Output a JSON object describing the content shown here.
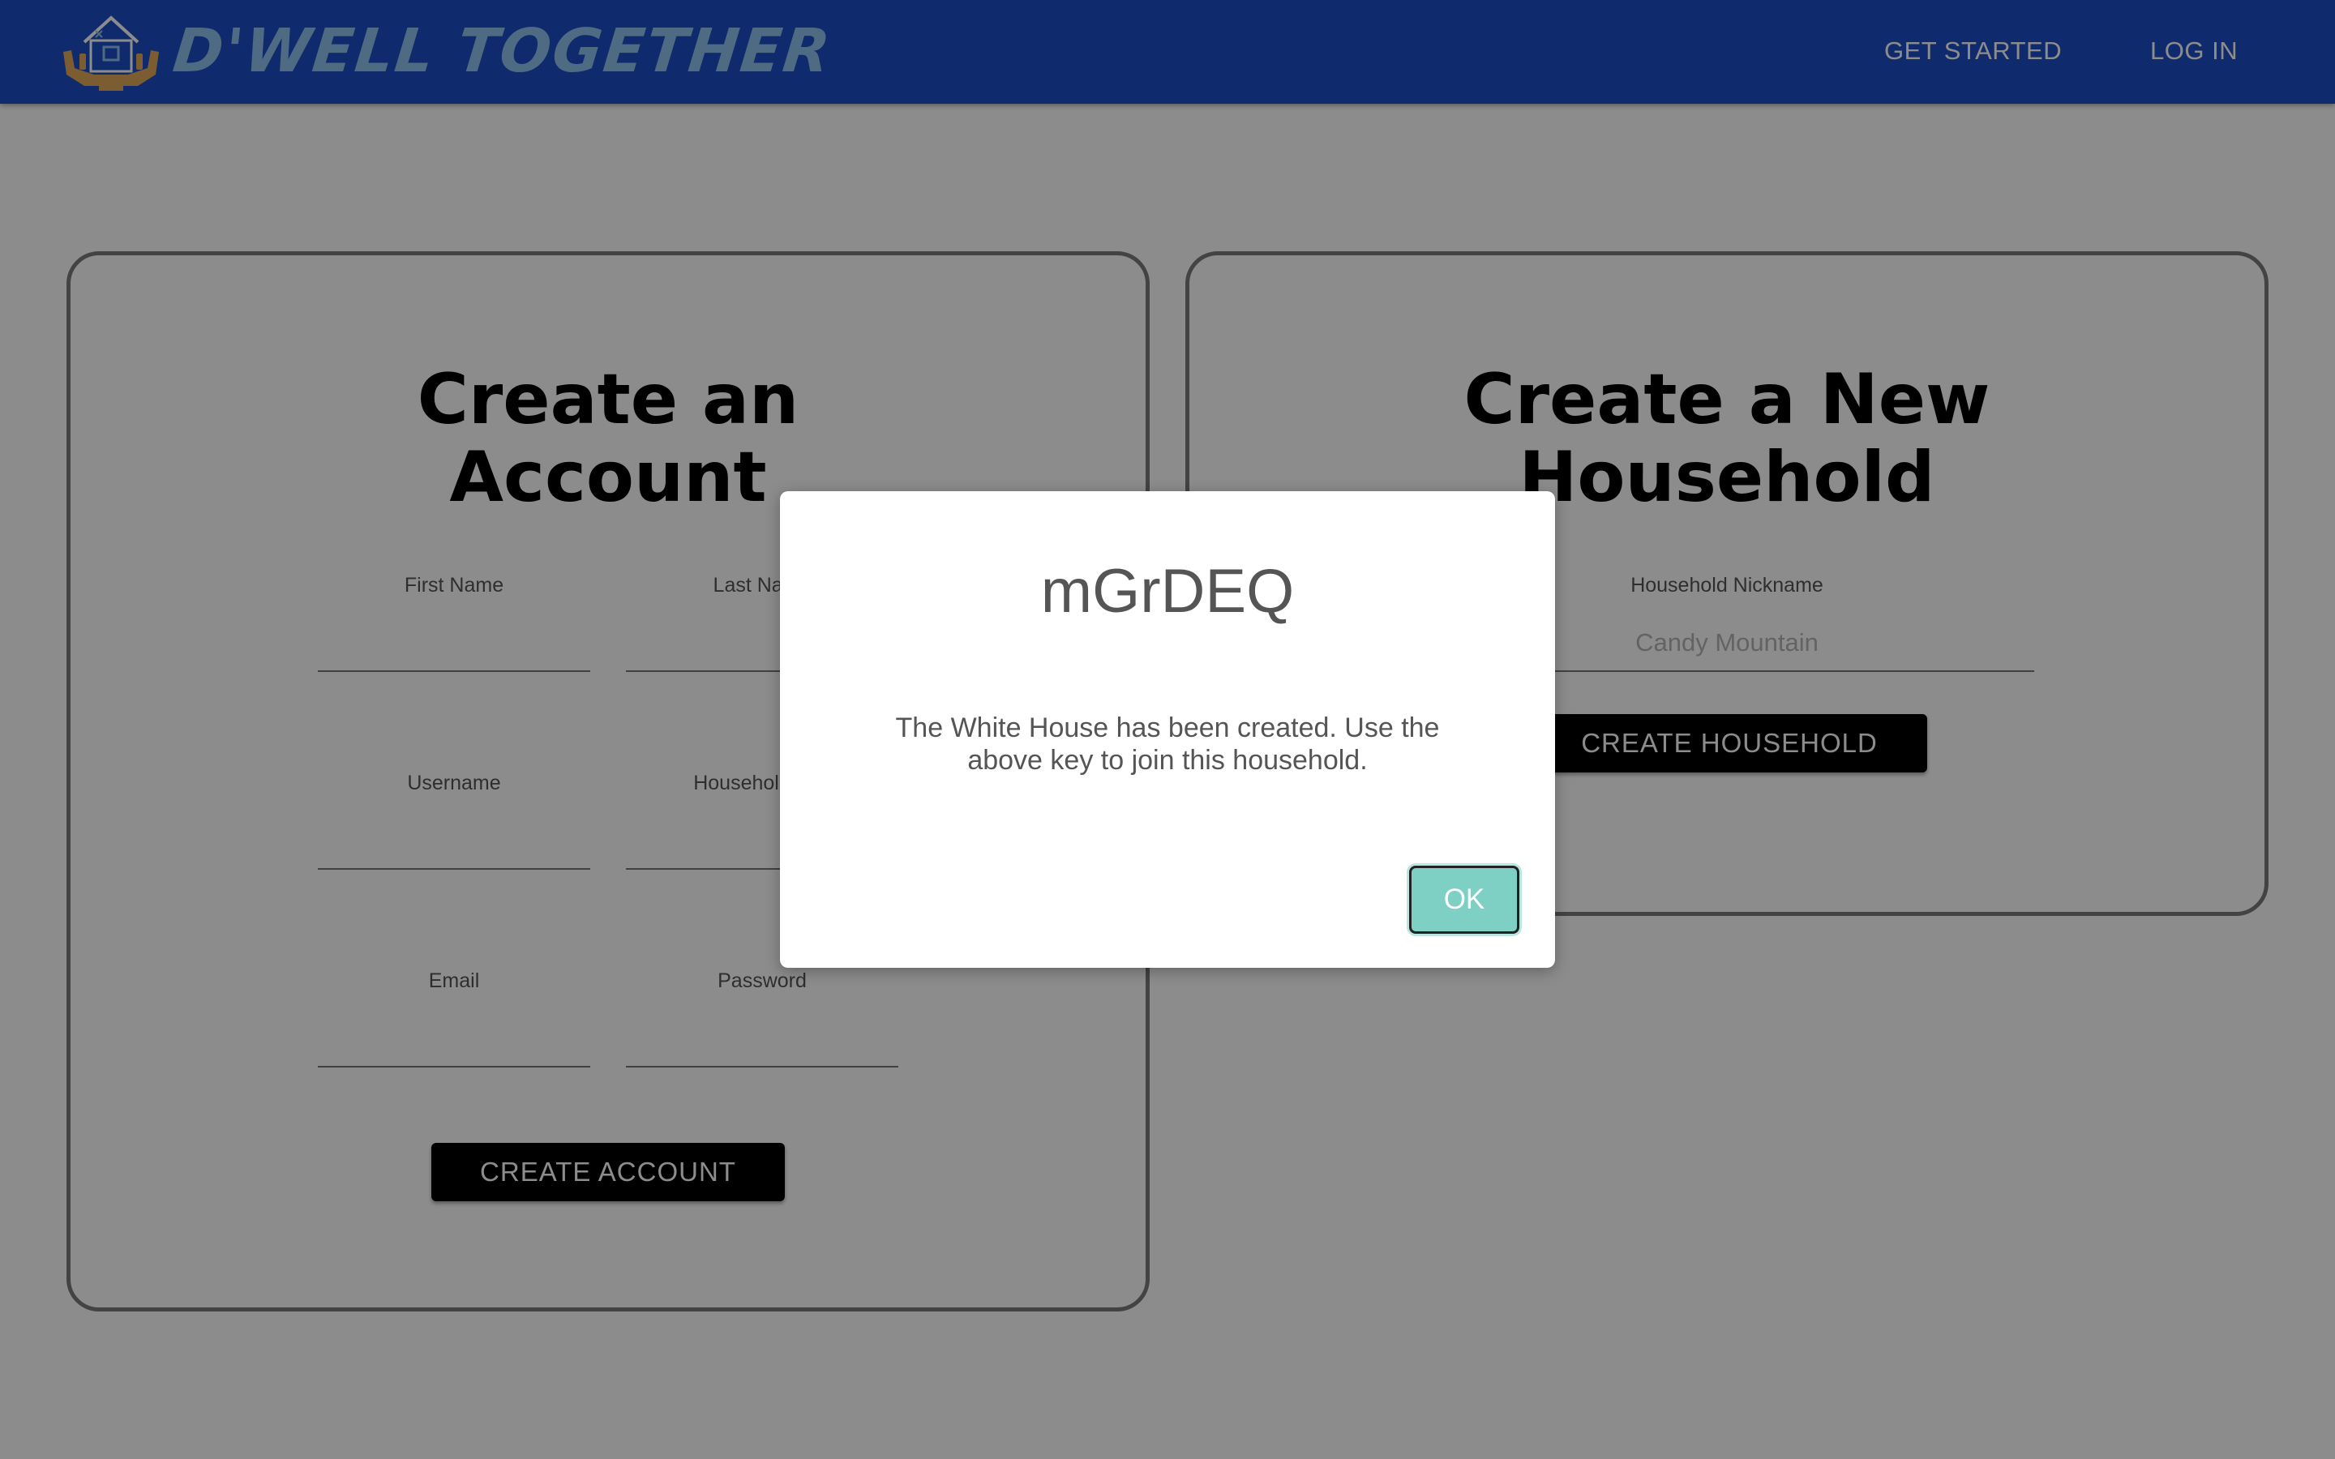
{
  "header": {
    "brand": "D'WELL TOGETHER",
    "logo_icon": "house-in-hands-icon",
    "nav": {
      "get_started": "GET STARTED",
      "log_in": "LOG IN"
    },
    "colors": {
      "bar": "#1e4fc6",
      "brand_text": "#8ec3ee"
    }
  },
  "account_card": {
    "title_line1": "Create an",
    "title_line2": "Account",
    "fields": {
      "first_name": {
        "label": "First Name",
        "value": ""
      },
      "last_name": {
        "label": "Last Name",
        "value": ""
      },
      "username": {
        "label": "Username",
        "value": ""
      },
      "household": {
        "label": "Household Key",
        "value": ""
      },
      "email": {
        "label": "Email",
        "value": ""
      },
      "password": {
        "label": "Password",
        "value": ""
      }
    },
    "submit_label": "CREATE ACCOUNT"
  },
  "household_card": {
    "title_line1": "Create a New",
    "title_line2": "Household",
    "nickname": {
      "label": "Household Nickname",
      "placeholder": "Candy Mountain",
      "value": ""
    },
    "submit_label": "CREATE HOUSEHOLD"
  },
  "modal": {
    "title": "mGrDEQ",
    "message": "The White House has been created. Use the above key to join this household.",
    "ok_label": "OK",
    "ok_color": "#7ecfc4"
  }
}
